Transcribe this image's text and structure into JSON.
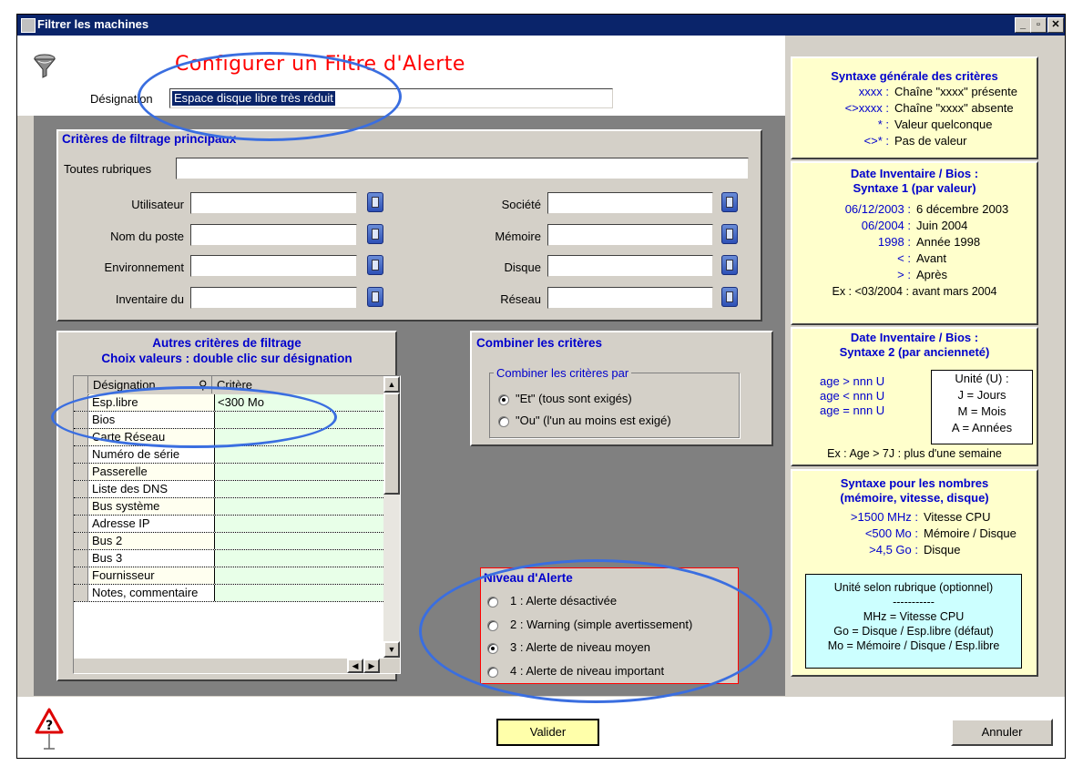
{
  "window": {
    "title": "Filtrer les machines",
    "buttons": {
      "minimize": "_",
      "maximize": "▫",
      "close": "✕"
    }
  },
  "header": {
    "heading": "Configurer un Filtre d'Alerte",
    "designation_label": "Désignation",
    "designation_value": "Espace disque libre très réduit"
  },
  "main_criteria": {
    "title": "Critères de filtrage principaux",
    "all_fields_label": "Toutes rubriques",
    "all_fields_value": "",
    "left_fields": [
      {
        "label": "Utilisateur",
        "value": ""
      },
      {
        "label": "Nom du poste",
        "value": ""
      },
      {
        "label": "Environnement",
        "value": ""
      },
      {
        "label": "Inventaire du",
        "value": ""
      }
    ],
    "right_fields": [
      {
        "label": "Société",
        "value": ""
      },
      {
        "label": "Mémoire",
        "value": ""
      },
      {
        "label": "Disque",
        "value": ""
      },
      {
        "label": "Réseau",
        "value": ""
      }
    ]
  },
  "other_criteria": {
    "title_line1": "Autres critères de filtrage",
    "title_line2": "Choix valeurs : double clic sur désignation",
    "columns": [
      "Désignation",
      "Critère"
    ],
    "rows": [
      {
        "designation": "Esp.libre",
        "critere": "<300 Mo"
      },
      {
        "designation": "Bios",
        "critere": ""
      },
      {
        "designation": "Carte Réseau",
        "critere": ""
      },
      {
        "designation": "Numéro de série",
        "critere": ""
      },
      {
        "designation": "Passerelle",
        "critere": ""
      },
      {
        "designation": "Liste des DNS",
        "critere": ""
      },
      {
        "designation": "Bus système",
        "critere": ""
      },
      {
        "designation": "Adresse IP",
        "critere": ""
      },
      {
        "designation": "Bus 2",
        "critere": ""
      },
      {
        "designation": "Bus 3",
        "critere": ""
      },
      {
        "designation": "Fournisseur",
        "critere": ""
      },
      {
        "designation": "Notes, commentaire",
        "critere": ""
      }
    ]
  },
  "combine": {
    "title": "Combiner les critères",
    "group_label": "Combiner les critères par",
    "options": [
      "\"Et\" (tous sont exigés)",
      "\"Ou\" (l'un au moins est exigé)"
    ],
    "selected": 0
  },
  "alert_level": {
    "title": "Niveau d'Alerte",
    "options": [
      "1 : Alerte désactivée",
      "2 : Warning (simple avertissement)",
      "3 : Alerte de niveau moyen",
      "4 : Alerte de niveau important"
    ],
    "selected": 2
  },
  "help": {
    "syntax_general": {
      "title": "Syntaxe générale des critères",
      "rows": [
        {
          "key": "xxxx :",
          "text": "Chaîne \"xxxx\" présente"
        },
        {
          "key": "<>xxxx :",
          "text": "Chaîne \"xxxx\" absente"
        },
        {
          "key": "* :",
          "text": "Valeur quelconque"
        },
        {
          "key": "<>* :",
          "text": "Pas de valeur"
        }
      ]
    },
    "date_syntax1": {
      "title_line1": "Date Inventaire / Bios :",
      "title_line2": "Syntaxe 1 (par valeur)",
      "rows": [
        {
          "key": "06/12/2003 :",
          "text": "6 décembre 2003"
        },
        {
          "key": "06/2004 :",
          "text": "Juin 2004"
        },
        {
          "key": "1998 :",
          "text": "Année 1998"
        },
        {
          "key": "< :",
          "text": "Avant"
        },
        {
          "key": "> :",
          "text": "Après"
        }
      ],
      "example": "Ex : <03/2004 : avant mars 2004"
    },
    "date_syntax2": {
      "title_line1": "Date Inventaire / Bios :",
      "title_line2": "Syntaxe 2 (par ancienneté)",
      "rows": [
        "age > nnn U",
        "age < nnn U",
        "age = nnn U"
      ],
      "units": [
        "Unité (U) :",
        "J = Jours",
        "M = Mois",
        "A = Années"
      ],
      "example": "Ex : Age > 7J : plus d'une semaine"
    },
    "numbers": {
      "title_line1": "Syntaxe pour les nombres",
      "title_line2": "(mémoire, vitesse, disque)",
      "rows": [
        {
          "key": ">1500 MHz :",
          "text": "Vitesse CPU"
        },
        {
          "key": "<500 Mo :",
          "text": "Mémoire / Disque"
        },
        {
          "key": ">4,5 Go :",
          "text": "Disque"
        }
      ],
      "units_box": [
        "Unité selon rubrique (optionnel)",
        "-----------",
        "MHz = Vitesse CPU",
        "Go = Disque / Esp.libre (défaut)",
        "Mo = Mémoire / Disque / Esp.libre"
      ]
    }
  },
  "buttons": {
    "validate": "Valider",
    "cancel": "Annuler"
  },
  "colors": {
    "titlebar": "#0a246a",
    "help_bg": "#ffffcc",
    "heading": "#ff0000",
    "accent_blue": "#0000cc",
    "annotation": "#3a6ee0"
  }
}
